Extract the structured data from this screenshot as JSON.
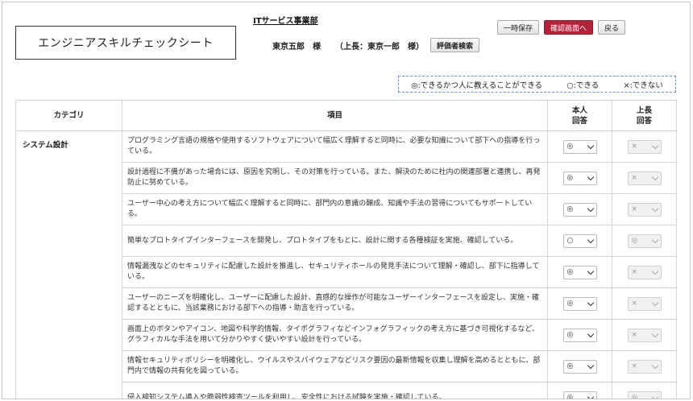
{
  "header": {
    "title": "エンジニアスキルチェックシート",
    "department_link": "ITサービス事業部",
    "user_name": "東京五郎　様",
    "boss": "（上長：東京一郎　様）",
    "evaluator_search_label": "評価者検索"
  },
  "toolbar": {
    "temp_save_label": "一時保存",
    "confirm_label": "確認画面へ",
    "back_label": "戻る"
  },
  "legend": {
    "double_circle": "◎:できるかつ人に教えることができる",
    "circle": "○:できる",
    "cross": "×:できない"
  },
  "table": {
    "headers": {
      "category": "カテゴリ",
      "item": "項目",
      "self_line1": "本人",
      "self_line2": "回答",
      "boss_line1": "上長",
      "boss_line2": "回答"
    },
    "category": "システム設計",
    "rows": [
      {
        "text": "プログラミング言語の規格や使用するソフトウェアについて幅広く理解すると同時に、必要な知識について部下への指導を行っている。",
        "self": "◎",
        "boss": "×"
      },
      {
        "text": "設計過程に不備があった場合には、原因を究明し、その対策を行っている。また、解決のために社内の関連部署と連携し、再発防止に努めている。",
        "self": "◎",
        "boss": "×"
      },
      {
        "text": "ユーザー中心の考え方について幅広く理解すると同時に、部門内の意識の醸成、知識や手法の習得についてもサポートしている。",
        "self": "◎",
        "boss": "×"
      },
      {
        "text": "簡単なプロトタイプインターフェースを開発し、プロトタイプをもとに、設計に関する各種検証を実施、確認している。",
        "self": "○",
        "boss": "◎"
      },
      {
        "text": "情報漏洩などのセキュリティに配慮した設計を推進し、セキュリティホールの発見手法について理解・確認し、部下に指導している。",
        "self": "◎",
        "boss": "×"
      },
      {
        "text": "ユーザーのニーズを明確化し、ユーザーに配慮した設計、直感的な操作が可能なユーザーインターフェースを設定し、実施・確認するとともに、当該業務における部下への指導・助言を行っている。",
        "self": "◎",
        "boss": "×"
      },
      {
        "text": "画面上のボタンやアイコン、地図や科学的情報、タイポグラフィなどインフォグラフィックの考え方に基づき可視化するなど、グラフィカルな手法を用いて分かりやすく使いやすい設計を行っている。",
        "self": "◎",
        "boss": "×"
      },
      {
        "text": "情報セキュリティポリシーを明確化し、ウイルスやスパイウェアなどリスク要因の最新情報を収集し理解を高めるとともに、部門内で情報の共有化を図っている。",
        "self": "◎",
        "boss": "×"
      },
      {
        "text": "侵入検知システム導入や脆弱性検査ツールを利用し、安全性における試験を実施・確認している。",
        "self": "◎",
        "boss": "◎"
      }
    ]
  }
}
